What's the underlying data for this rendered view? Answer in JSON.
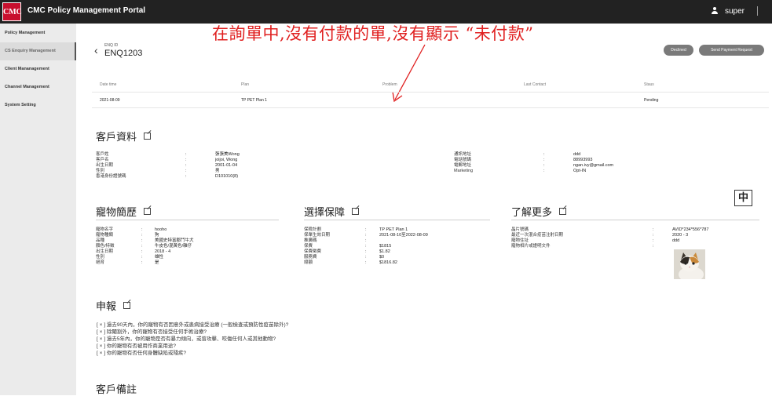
{
  "header": {
    "logo_text": "CMC",
    "app_title": "CMC Policy Management Portal",
    "user_name": "super"
  },
  "sidebar": {
    "items": [
      {
        "label": "Policy Management"
      },
      {
        "label": "CS Enquiry Management"
      },
      {
        "label": "Client Mananagement"
      },
      {
        "label": "Channel Management"
      },
      {
        "label": "System Setting"
      }
    ]
  },
  "enquiry": {
    "id_label": "ENQ ID",
    "id_value": "ENQ1203",
    "declined_label": "Declined",
    "send_payment_label": "Send Payment Request"
  },
  "annotation": {
    "text": "在詢單中,沒有付款的單,沒有顯示 “未付款”",
    "color": "#e02020"
  },
  "table": {
    "headers": [
      "Date time",
      "Plan",
      "Problem",
      "Last Contact",
      "Staus"
    ],
    "rows": [
      [
        "2021-08-09",
        "TP PET Plan 1",
        "",
        "",
        "Pending"
      ]
    ]
  },
  "client_info": {
    "title": "客戶資料",
    "left": [
      {
        "k": "客戶姓",
        "v": "張張美Wong"
      },
      {
        "k": "客戶名",
        "v": "joijoi, Wong"
      },
      {
        "k": "出生日期",
        "v": "2001-01-04"
      },
      {
        "k": "性別",
        "v": "男"
      },
      {
        "k": "香港身份證號碼",
        "v": "D101010(8)"
      }
    ],
    "right": [
      {
        "k": "通訊地址",
        "v": "ddd"
      },
      {
        "k": "電話號碼",
        "v": "88993993"
      },
      {
        "k": "電郵地址",
        "v": "ngan.ivy@gmail.com"
      },
      {
        "k": "Marketing",
        "v": "Opt-IN"
      }
    ]
  },
  "zhong_box": "中",
  "pet_profile": {
    "title": "寵物簡歷",
    "rows": [
      {
        "k": "寵物名字",
        "v": "hooho"
      },
      {
        "k": "寵物種類",
        "v": "狗"
      },
      {
        "k": "品種",
        "v": "美國史特富郡鬥牛犬"
      },
      {
        "k": "顏色/特徵",
        "v": "牛皮色/混黃色/雜仔"
      },
      {
        "k": "出生日期",
        "v": "2018 - 4"
      },
      {
        "k": "性別",
        "v": "雄性"
      },
      {
        "k": "絕育",
        "v": "是"
      }
    ]
  },
  "coverage": {
    "title": "選擇保障",
    "rows": [
      {
        "k": "保險計劃",
        "v": "TP PET Plan 1"
      },
      {
        "k": "保單生效日期",
        "v": "2021-08-10至2022-08-09"
      },
      {
        "k": "推廣碼",
        "v": ""
      },
      {
        "k": "保費",
        "v": "$1815"
      },
      {
        "k": "保費徵費",
        "v": "$1.82"
      },
      {
        "k": "服務費",
        "v": "$0"
      },
      {
        "k": "總額",
        "v": "$1816.82"
      }
    ]
  },
  "more_info": {
    "title": "了解更多",
    "rows": [
      {
        "k": "晶片號碼",
        "v": "AVID*234*556*787"
      },
      {
        "k": "最近一次混合疫苗注射日期",
        "v": "2020 - 3"
      },
      {
        "k": "寵物住址",
        "v": "ddd"
      },
      {
        "k": "寵物相片或證明文件",
        "v": ""
      }
    ]
  },
  "declaration": {
    "title": "申報",
    "items": [
      "[ × ] 過去90天內，你的寵物有否因意外或患病接受治療 (一般檢查或預防性疫苗除外)?",
      "[ × ] 除閹割外，你的寵物有否接受任何手術治療?",
      "[ × ] 過去5年內，你的寵物是否有暴力傾向，或曾攻擊、咬傷任何人或其他動物?",
      "[ × ] 你的寵物有否被用作商業用途?",
      "[ × ] 你的寵物有否任何身體缺陷或殘疾?"
    ]
  },
  "client_remarks": {
    "title": "客戶備註"
  }
}
